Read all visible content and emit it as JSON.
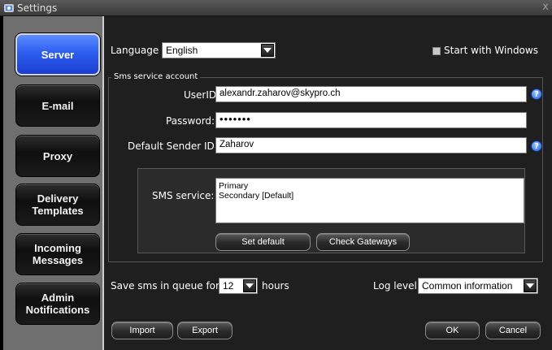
{
  "window": {
    "title": "Settings"
  },
  "sidebar": {
    "items": [
      {
        "label": "Server",
        "active": true
      },
      {
        "label": "E-mail"
      },
      {
        "label": "Proxy"
      },
      {
        "label": "Delivery Templates"
      },
      {
        "label": "Incoming Messages"
      },
      {
        "label": "Admin Notifications"
      }
    ]
  },
  "server": {
    "language_label": "Language",
    "language_value": "English",
    "start_with_windows_label": "Start with Windows",
    "sms_group_label": "Sms service account",
    "userid_label": "UserID:",
    "userid_value": "alexandr.zaharov@skypro.ch",
    "password_label": "Password:",
    "password_value": "•••••••",
    "sender_label": "Default Sender ID:",
    "sender_value": "Zaharov",
    "sms_service_label": "SMS service:",
    "sms_services": [
      "Primary",
      "Secondary [Default]"
    ],
    "set_default_label": "Set default",
    "check_gateways_label": "Check Gateways",
    "queue_label": "Save sms in queue for",
    "queue_value": "12",
    "queue_unit": "hours",
    "log_level_label": "Log level",
    "log_level_value": "Common information"
  },
  "footer": {
    "import_label": "Import",
    "export_label": "Export",
    "ok_label": "OK",
    "cancel_label": "Cancel"
  },
  "icons": {
    "help": "?",
    "close": "x"
  },
  "colors": {
    "active_tab": "#2c5ef0",
    "sidebar_bg": "#6f6f6f",
    "content_bg": "#1f1f1f",
    "help_icon": "#2460d8"
  }
}
